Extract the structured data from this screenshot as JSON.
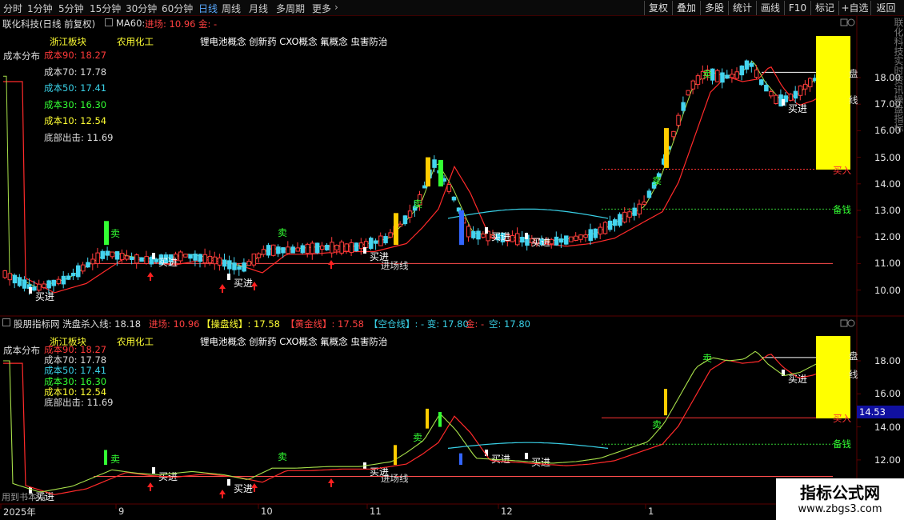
{
  "toolbar": {
    "timeframes": [
      "分时",
      "1分钟",
      "5分钟",
      "15分钟",
      "30分钟",
      "60分钟",
      "日线",
      "周线",
      "月线",
      "多周期",
      "更多"
    ],
    "active": "日线",
    "right_buttons": [
      "复权",
      "叠加",
      "多股",
      "统计",
      "画线",
      "F10",
      "标记",
      "+自选",
      "返回"
    ]
  },
  "main": {
    "stock_title": "联化科技(日线 前复权)",
    "ma_label": "MA60:",
    "entry_label": "进场: 10.96",
    "gold_label": "金: -",
    "cost_title": "成本分布",
    "tags": {
      "region": "浙江板块",
      "industry": "农用化工",
      "concepts": "锂电池概念 创新药 CXO概念 氟概念 虫害防治"
    },
    "cost_lines": [
      {
        "label": "成本90: 18.27",
        "color": "#ff3a3a"
      },
      {
        "label": "成本70: 17.78",
        "color": "#dcdcdc"
      },
      {
        "label": "成本50: 17.41",
        "color": "#39d0e6"
      },
      {
        "label": "成本30: 16.30",
        "color": "#33ff33"
      },
      {
        "label": "成本10: 12.54",
        "color": "#ffff33"
      },
      {
        "label": "底部出击: 11.69",
        "color": "#dcdcdc"
      }
    ],
    "price_axis": [
      "18.00",
      "17.00",
      "16.00",
      "15.00",
      "14.00",
      "13.00",
      "12.00",
      "11.00",
      "10.00"
    ],
    "sig_buy": "买进",
    "sig_sell": "卖",
    "sig_entry_line": "进场线",
    "sig_buy_in": "买入",
    "sig_money": "备钱",
    "sig_pan": "盘",
    "sig_line": "线"
  },
  "indicator": {
    "title": "股朋指标网 洗盘杀入线: 18.18",
    "entry": "进场: 10.96",
    "op_line": "【操盘线】: 17.58",
    "gold_line": "【黄金线】: 17.58",
    "empty_line": "【空仓线】: - 变: 17.80",
    "gold": "金: -",
    "empty": "空: 17.80",
    "price_axis": [
      "18.00",
      "16.00",
      "14.00",
      "12.00"
    ],
    "current_price": "14.53",
    "watermark": "用到书本指"
  },
  "date_axis": {
    "labels": [
      "2025年",
      "9",
      "10",
      "11",
      "12",
      "1"
    ]
  },
  "logo": {
    "title": "指标公式网",
    "url": "www.zbgs3.com"
  },
  "right_strip": "联化科技实时资讯操盘指标"
}
